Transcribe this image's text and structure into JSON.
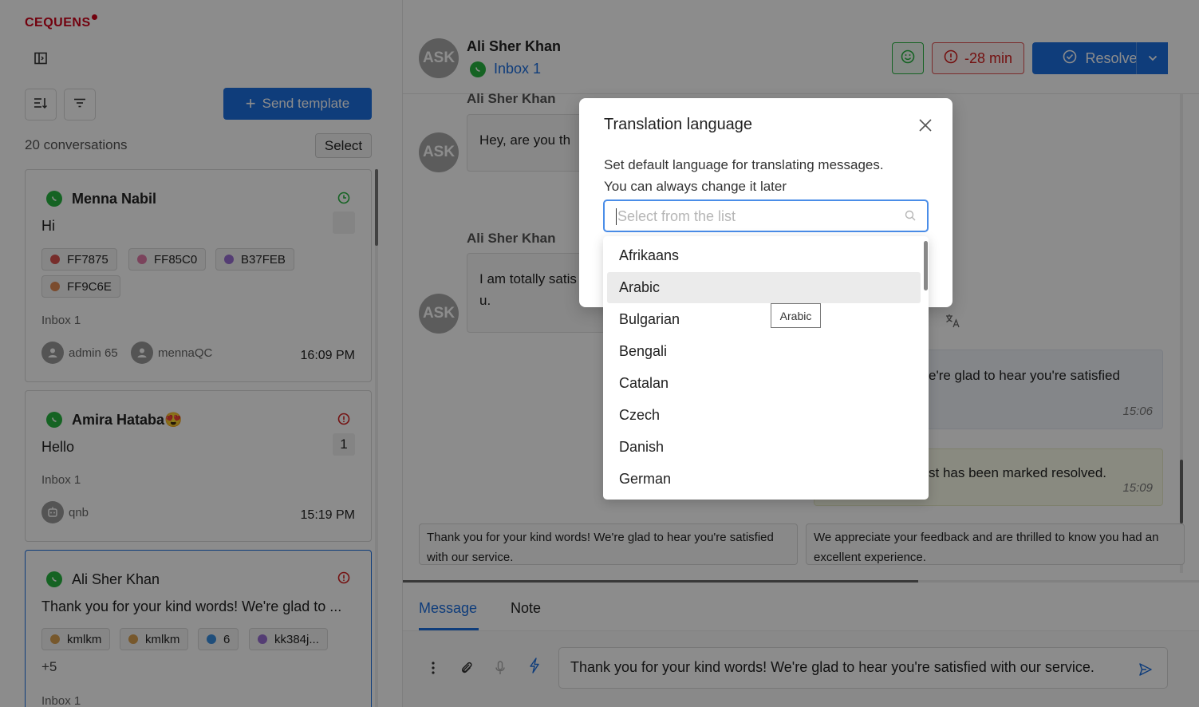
{
  "brand": {
    "logo_text": "CEQUENS"
  },
  "sidebar": {
    "send_template_label": "Send template",
    "conversation_count": "20 conversations",
    "select_label": "Select",
    "conversations": [
      {
        "name": "Menna Nabil",
        "message": "Hi",
        "tags": [
          {
            "label": "FF7875",
            "color": "#d9534f"
          },
          {
            "label": "FF85C0",
            "color": "#e07aa8"
          },
          {
            "label": "B37FEB",
            "color": "#9a6fd4"
          },
          {
            "label": "FF9C6E",
            "color": "#e08a55"
          }
        ],
        "inbox": "Inbox 1",
        "agents": [
          "admin 65",
          "mennaQC"
        ],
        "time": "16:09 PM",
        "status_color": "#27b440"
      },
      {
        "name": "Amira Hataba",
        "emoji": "😍",
        "message": "Hello",
        "unread": "1",
        "inbox": "Inbox 1",
        "agents": [
          "qnb"
        ],
        "time": "15:19 PM",
        "status_color": "#d42020"
      },
      {
        "name": "Ali Sher Khan",
        "message": "Thank you for your kind words! We're glad to ...",
        "tags": [
          {
            "label": "kmlkm",
            "color": "#d9a050"
          },
          {
            "label": "kmlkm",
            "color": "#d9a050"
          },
          {
            "label": "6",
            "color": "#3a8ee0"
          },
          {
            "label": "kk384j...",
            "color": "#9a6fd4"
          }
        ],
        "more_tags": "+5",
        "inbox": "Inbox 1",
        "status_color": "#d42020"
      }
    ]
  },
  "chat": {
    "avatar_initials": "ASK",
    "contact_name": "Ali Sher Khan",
    "inbox": "Inbox 1",
    "sla_label": "-28 min",
    "resolve_label": "Resolve",
    "sender_top": "Ali Sher Khan",
    "msg1": "Hey, are you th",
    "sender2": "Ali Sher Khan",
    "msg2_line1": "I am totally satis",
    "msg2_line2": "u.",
    "out1_text": "e're glad to hear you're satisfied",
    "out1_time": "15:06",
    "out2_text": "st has been marked resolved.",
    "out2_time": "15:09",
    "suggestions": [
      "Thank you for your kind words! We're glad to hear you're satisfied with our service.",
      "We appreciate your feedback and are thrilled to know you had an excellent experience."
    ],
    "tab_message": "Message",
    "tab_note": "Note",
    "composer_text": "Thank you for your kind words! We're glad to hear you're satisfied with our service."
  },
  "modal": {
    "title": "Translation language",
    "description_line1": "Set default language for translating messages.",
    "description_line2": "You can always change it later",
    "placeholder": "Select from the list",
    "languages": [
      "Afrikaans",
      "Arabic",
      "Bulgarian",
      "Bengali",
      "Catalan",
      "Czech",
      "Danish",
      "German"
    ],
    "hovered": "Arabic",
    "tooltip": "Arabic"
  }
}
